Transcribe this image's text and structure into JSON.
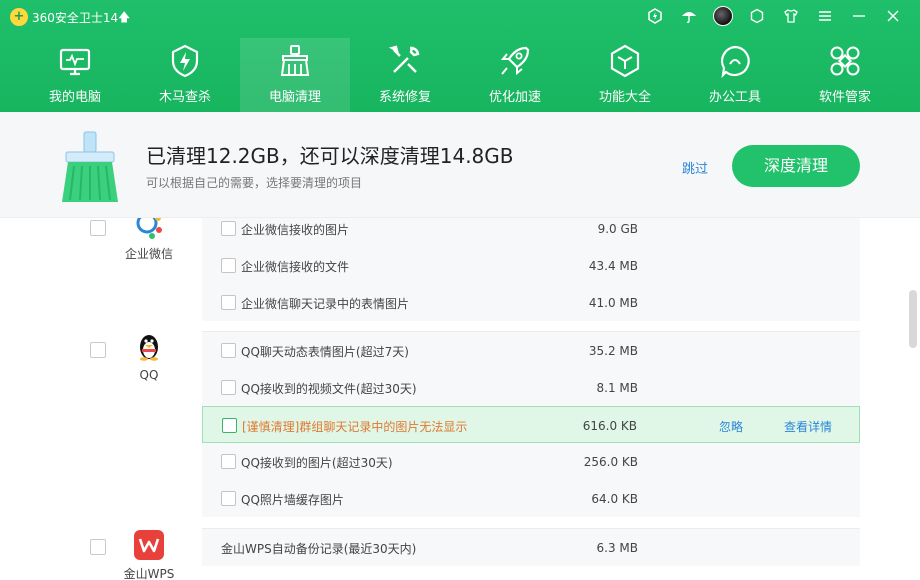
{
  "app": {
    "title": "360安全卫士14",
    "logo_text": "+"
  },
  "nav": [
    {
      "label": "我的电脑",
      "icon": "monitor-icon"
    },
    {
      "label": "木马查杀",
      "icon": "shield-bolt-icon"
    },
    {
      "label": "电脑清理",
      "icon": "broom-icon",
      "active": true
    },
    {
      "label": "系统修复",
      "icon": "wrench-screwdriver-icon"
    },
    {
      "label": "优化加速",
      "icon": "rocket-icon"
    },
    {
      "label": "功能大全",
      "icon": "cube-icon"
    },
    {
      "label": "办公工具",
      "icon": "office-icon"
    },
    {
      "label": "软件管家",
      "icon": "grid-flower-icon"
    }
  ],
  "banner": {
    "title": "已清理12.2GB，还可以深度清理14.8GB",
    "subtitle": "可以根据自己的需要，选择要清理的项目",
    "skip": "跳过",
    "button": "深度清理"
  },
  "groups": [
    {
      "name": "企业微信",
      "items": [
        {
          "label": "企业微信接收的图片",
          "size": "9.0 GB"
        },
        {
          "label": "企业微信接收的文件",
          "size": "43.4 MB"
        },
        {
          "label": "企业微信聊天记录中的表情图片",
          "size": "41.0 MB"
        }
      ]
    },
    {
      "name": "QQ",
      "items": [
        {
          "label": "QQ聊天动态表情图片(超过7天)",
          "size": "35.2 MB"
        },
        {
          "label": "QQ接收到的视频文件(超过30天)",
          "size": "8.1 MB"
        },
        {
          "label": "[谨慎清理]群组聊天记录中的图片无法显示",
          "size": "616.0 KB",
          "ignore": "忽略",
          "details": "查看详情"
        },
        {
          "label": "QQ接收到的图片(超过30天)",
          "size": "256.0 KB"
        },
        {
          "label": "QQ照片墙缓存图片",
          "size": "64.0 KB"
        }
      ]
    },
    {
      "name": "金山WPS",
      "items": [
        {
          "label": "金山WPS自动备份记录(最近30天内)",
          "size": "6.3 MB"
        }
      ]
    }
  ]
}
